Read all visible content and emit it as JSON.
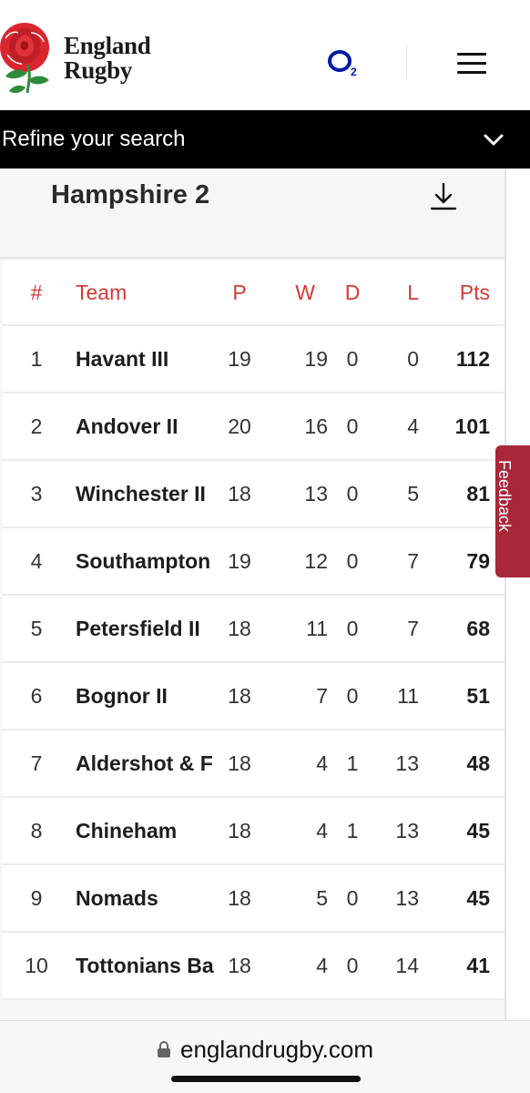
{
  "header": {
    "logo_line1": "England",
    "logo_line2": "Rugby",
    "sponsor_icon": "o2-logo",
    "menu_icon": "hamburger-icon"
  },
  "refine": {
    "label": "Refine your search",
    "icon": "chevron-down-icon"
  },
  "league": {
    "title": "Hampshire 2",
    "download_icon": "download-icon"
  },
  "table": {
    "columns": {
      "rank": "#",
      "team": "Team",
      "played": "P",
      "won": "W",
      "drawn": "D",
      "lost": "L",
      "points": "Pts"
    },
    "rows": [
      {
        "rank": "1",
        "team": "Havant III",
        "played": "19",
        "won": "19",
        "drawn": "0",
        "lost": "0",
        "points": "112"
      },
      {
        "rank": "2",
        "team": "Andover II",
        "played": "20",
        "won": "16",
        "drawn": "0",
        "lost": "4",
        "points": "101"
      },
      {
        "rank": "3",
        "team": "Winchester II",
        "played": "18",
        "won": "13",
        "drawn": "0",
        "lost": "5",
        "points": "81"
      },
      {
        "rank": "4",
        "team": "Southampton",
        "played": "19",
        "won": "12",
        "drawn": "0",
        "lost": "7",
        "points": "79"
      },
      {
        "rank": "5",
        "team": "Petersfield II",
        "played": "18",
        "won": "11",
        "drawn": "0",
        "lost": "7",
        "points": "68"
      },
      {
        "rank": "6",
        "team": "Bognor II",
        "played": "18",
        "won": "7",
        "drawn": "0",
        "lost": "11",
        "points": "51"
      },
      {
        "rank": "7",
        "team": "Aldershot & F",
        "played": "18",
        "won": "4",
        "drawn": "1",
        "lost": "13",
        "points": "48"
      },
      {
        "rank": "8",
        "team": "Chineham",
        "played": "18",
        "won": "4",
        "drawn": "1",
        "lost": "13",
        "points": "45"
      },
      {
        "rank": "9",
        "team": "Nomads",
        "played": "18",
        "won": "5",
        "drawn": "0",
        "lost": "13",
        "points": "45"
      },
      {
        "rank": "10",
        "team": "Tottonians Ba",
        "played": "18",
        "won": "4",
        "drawn": "0",
        "lost": "14",
        "points": "41"
      }
    ]
  },
  "feedback": {
    "label": "Feedback"
  },
  "browser": {
    "url": "englandrugby.com",
    "lock_icon": "lock-icon"
  },
  "colors": {
    "accent_red": "#d43a35",
    "feedback_bg": "#a8283a",
    "refine_bg": "#000000",
    "o2_blue": "#0019a5"
  }
}
